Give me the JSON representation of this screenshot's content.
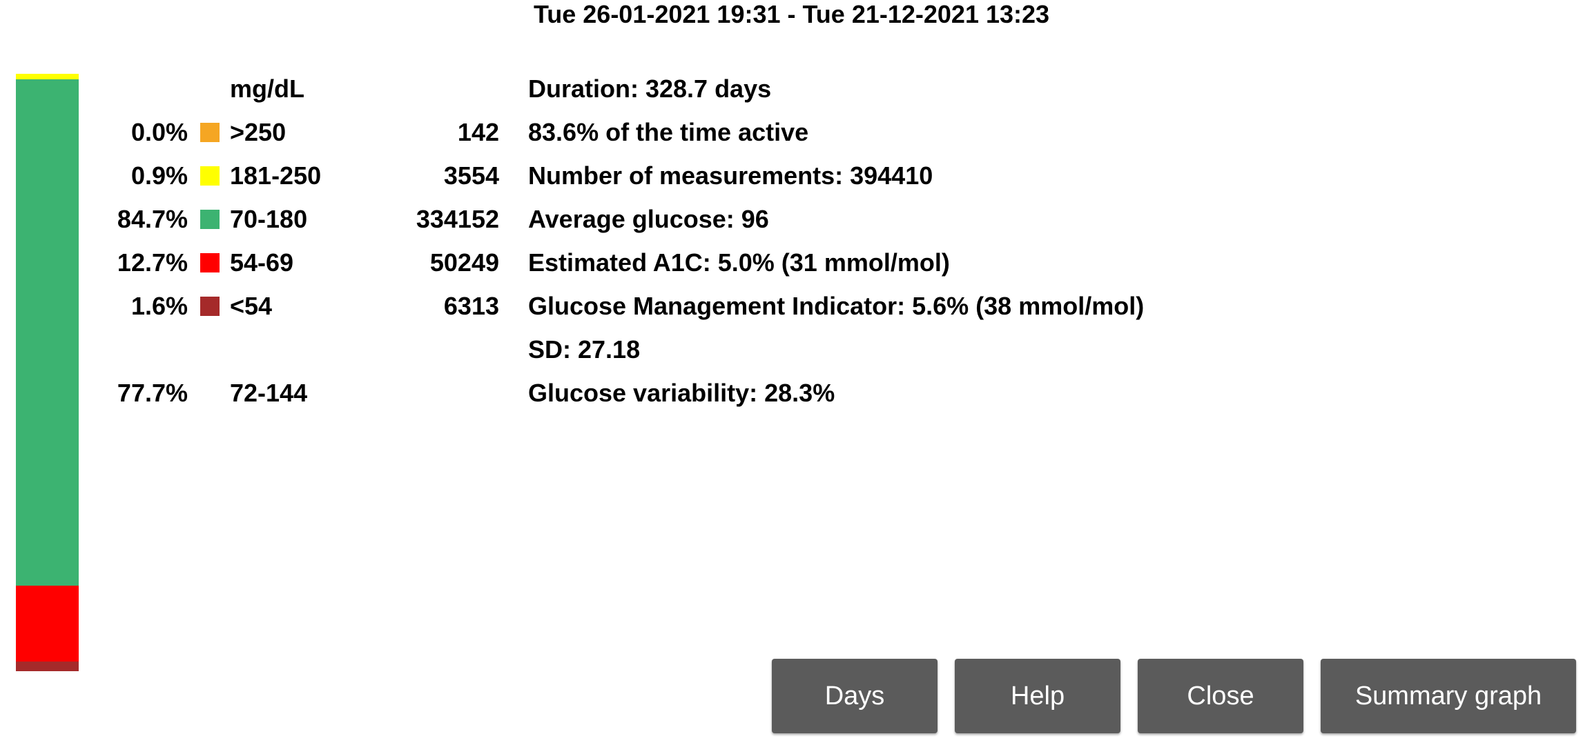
{
  "title": "Tue 26-01-2021 19:31 - Tue 21-12-2021 13:23",
  "unit_label": "mg/dL",
  "range_bar": [
    {
      "name": ">250",
      "fraction": 0.0,
      "color": "#f5a623"
    },
    {
      "name": "181-250",
      "fraction": 0.009,
      "color": "#ffff00"
    },
    {
      "name": "70-180",
      "fraction": 0.847,
      "color": "#3cb371"
    },
    {
      "name": "54-69",
      "fraction": 0.127,
      "color": "#ff0000"
    },
    {
      "name": "<54",
      "fraction": 0.016,
      "color": "#a52a2a"
    }
  ],
  "ranges": [
    {
      "pct": "0.0%",
      "range": ">250",
      "count": "142",
      "color": "#f5a623"
    },
    {
      "pct": "0.9%",
      "range": "181-250",
      "count": "3554",
      "color": "#ffff00"
    },
    {
      "pct": "84.7%",
      "range": "70-180",
      "count": "334152",
      "color": "#3cb371"
    },
    {
      "pct": "12.7%",
      "range": "54-69",
      "count": "50249",
      "color": "#ff0000"
    },
    {
      "pct": "1.6%",
      "range": "<54",
      "count": "6313",
      "color": "#a52a2a"
    }
  ],
  "tight_range": {
    "pct": "77.7%",
    "range": "72-144"
  },
  "stats": {
    "duration": "Duration: 328.7 days",
    "active": "83.6% of the time active",
    "measurements": "Number of measurements: 394410",
    "average": "Average glucose:  96",
    "a1c": "Estimated A1C: 5.0% (31 mmol/mol)",
    "gmi": "Glucose Management Indicator: 5.6% (38 mmol/mol)",
    "sd": "SD: 27.18",
    "variability": "Glucose variability: 28.3%"
  },
  "buttons": {
    "days": "Days",
    "help": "Help",
    "close": "Close",
    "summary_graph": "Summary graph"
  }
}
